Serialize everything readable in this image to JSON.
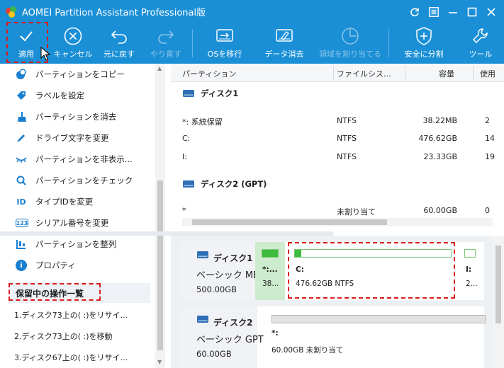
{
  "window": {
    "title": "AOMEI Partition Assistant Professional版"
  },
  "toolbar": {
    "items": [
      {
        "label": "適用",
        "icon": "check-icon"
      },
      {
        "label": "キャンセル",
        "icon": "cancel-icon"
      },
      {
        "label": "元に戻す",
        "icon": "undo-icon"
      },
      {
        "label": "やり直す",
        "icon": "redo-icon"
      },
      {
        "label": "OSを移行",
        "icon": "migrate-os-icon"
      },
      {
        "label": "データ消去",
        "icon": "wipe-data-icon"
      },
      {
        "label": "領域を割り当てる",
        "icon": "allocate-space-icon"
      },
      {
        "label": "安全に分割",
        "icon": "safe-split-icon"
      },
      {
        "label": "ツール",
        "icon": "tools-icon"
      }
    ]
  },
  "sidebar": {
    "items": [
      {
        "label": "パーティションをコピー",
        "icon": "copy-partition-icon"
      },
      {
        "label": "ラベルを設定",
        "icon": "label-tag-icon"
      },
      {
        "label": "パーティションを消去",
        "icon": "broom-icon"
      },
      {
        "label": "ドライブ文字を変更",
        "icon": "drive-letter-icon"
      },
      {
        "label": "パーティションを非表示...",
        "icon": "hide-eye-icon"
      },
      {
        "label": "パーティションをチェック",
        "icon": "check-search-icon"
      },
      {
        "label": "タイプIDを変更",
        "icon": "id-icon"
      },
      {
        "label": "シリアル番号を変更",
        "icon": "serial-number-icon"
      },
      {
        "label": "パーティションを整列",
        "icon": "align-icon"
      },
      {
        "label": "プロパティ",
        "icon": "info-icon"
      }
    ],
    "id_glyph": "ID",
    "serial_glyph": "123",
    "info_glyph": "i",
    "pending_title": "保留中の操作一覧",
    "pending": [
      "1.ディスク73上の(   :)をリサイ...",
      "2.ディスク73上の(   :)を移動",
      "3.ディスク67上の(   :)をリサイ..."
    ]
  },
  "table": {
    "headers": [
      "パーティション",
      "ファイルシス...",
      "容量",
      "使用"
    ],
    "disks": [
      {
        "name": "ディスク1",
        "partitions": [
          {
            "name": "*: 系統保留",
            "fs": "NTFS",
            "capacity": "38.22MB",
            "used": "2"
          },
          {
            "name": "C:",
            "fs": "NTFS",
            "capacity": "476.62GB",
            "used": "14"
          },
          {
            "name": "I:",
            "fs": "NTFS",
            "capacity": "23.33GB",
            "used": "19"
          }
        ]
      },
      {
        "name": "ディスク2 (GPT)",
        "partitions": [
          {
            "name": "*",
            "fs": "未割り当て",
            "capacity": "60.00GB",
            "used": "0"
          }
        ]
      }
    ]
  },
  "diskmap": {
    "disks": [
      {
        "name": "ディスク1",
        "type": "ベーシック MBR",
        "size": "500.00GB",
        "partitions": [
          {
            "label": "*:...",
            "detail": "38...",
            "fill": 1.0
          },
          {
            "label": "C:",
            "detail": "476.62GB NTFS",
            "fill": 0.04
          },
          {
            "label": "I:",
            "detail": "2...",
            "fill": 0.0
          }
        ]
      },
      {
        "name": "ディスク2",
        "type": "ベーシック GPT",
        "size": "60.00GB",
        "partitions": [
          {
            "label": "*:",
            "detail": "60.00GB 未割り当て",
            "fill": 0.0
          }
        ]
      }
    ]
  }
}
